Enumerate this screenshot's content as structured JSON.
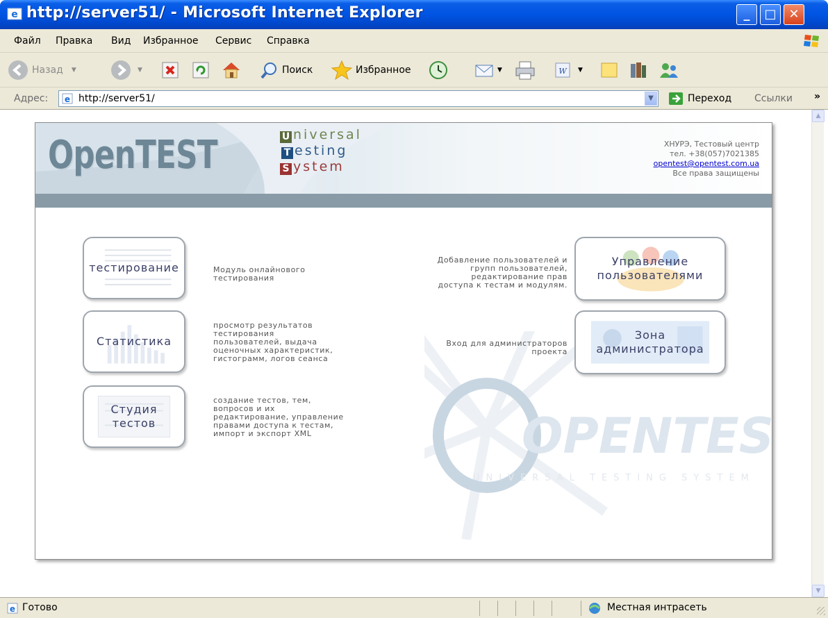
{
  "window": {
    "title": "http://server51/ - Microsoft Internet Explorer",
    "controls": {
      "minimize": "minimize",
      "maximize": "maximize",
      "close": "close"
    }
  },
  "menu": [
    "Файл",
    "Правка",
    "Вид",
    "Избранное",
    "Сервис",
    "Справка"
  ],
  "toolbar": {
    "back": "Назад",
    "search": "Поиск",
    "favorites": "Избранное"
  },
  "address": {
    "label": "Адрес:",
    "url": "http://server51/",
    "go": "Переход",
    "links": "Ссылки"
  },
  "page": {
    "logo": "OpenTEST",
    "tagline": {
      "line1_initial": "U",
      "line1_rest": "niversal",
      "line2_initial": "T",
      "line2_rest": "esting",
      "line3_initial": "S",
      "line3_rest": "ystem"
    },
    "contact": {
      "org": "ХНУРЭ, Тестовый центр",
      "phone": "тел. +38(057)7021385",
      "email": "opentest@opentest.com.ua",
      "rights": "Все права защищены"
    },
    "watermark": {
      "brand": "OPENTEST",
      "sub": "UNIVERSAL TESTING SYSTEM"
    },
    "modules": [
      {
        "label": "тестирование",
        "desc": "Модуль онлайнового\nтестирования"
      },
      {
        "label": "Статистика",
        "desc": "просмотр результатов\nтестирования\nпользователей, выдача\nоценочных характеристик,\nгистограмм, логов сеанса"
      },
      {
        "label": "Студия\nтестов",
        "desc": "создание тестов, тем,\nвопросов и их\nредактирование, управление\nправами доступа к тестам,\nимпорт и экспорт XML"
      },
      {
        "label": "Управление\nпользователями",
        "desc": "Добавление пользователей и\nгрупп пользователей,\nредактирование прав\nдоступа к тестам и модулям."
      },
      {
        "label": "Зона\nадминистратора",
        "desc": "Вход для администраторов\nпроекта"
      }
    ]
  },
  "status": {
    "text": "Готово",
    "zone": "Местная интрасеть"
  }
}
